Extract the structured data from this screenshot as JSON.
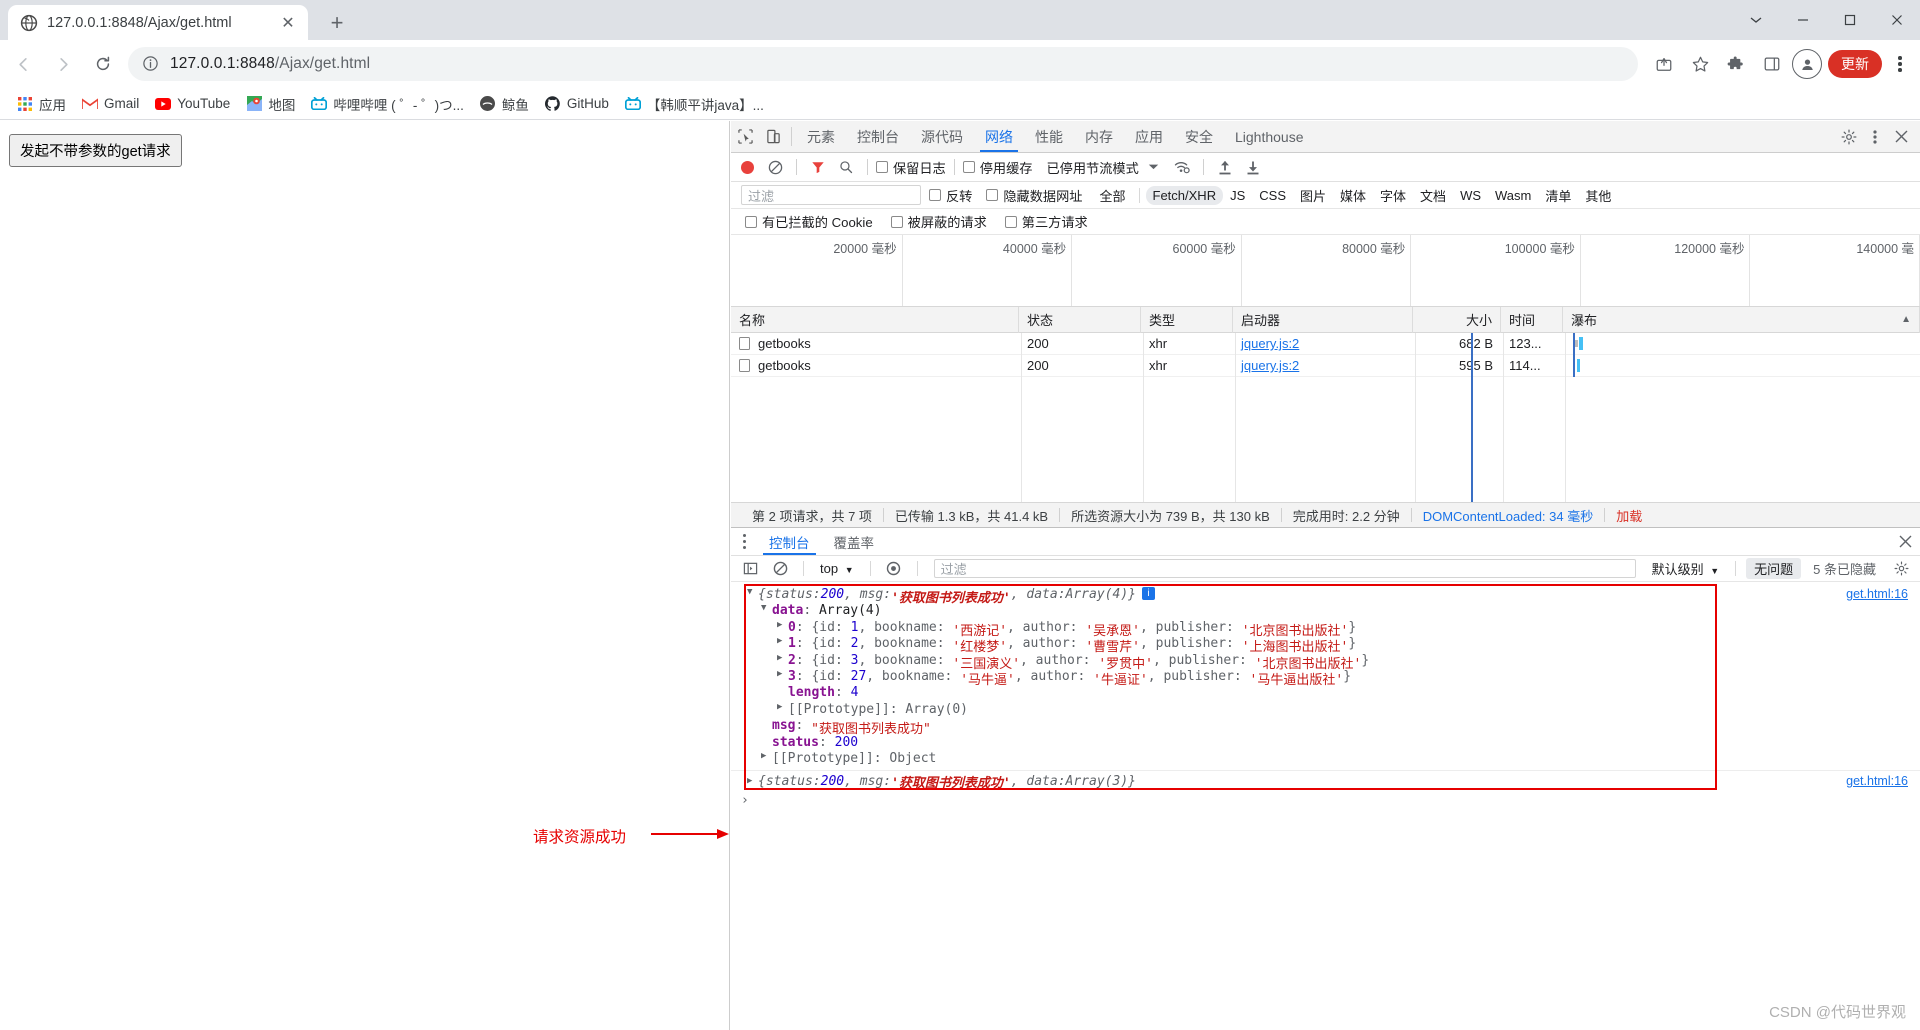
{
  "browser": {
    "tab": {
      "title": "127.0.0.1:8848/Ajax/get.html",
      "favicon": "globe-icon",
      "close": "✕"
    },
    "newtab_label": "+",
    "window_controls": {
      "restore_down": "⌄",
      "minimize": "─",
      "maximize": "❐",
      "close": "✕"
    },
    "nav": {
      "back": "←",
      "forward": "→",
      "reload": "↻"
    },
    "omnibox": {
      "info_icon": "info-circle-icon",
      "url_main": "127.0.0.1:8848",
      "url_path": "/Ajax/get.html"
    },
    "toolbar_icons": {
      "share": "⤴",
      "bookmark": "☆",
      "extensions": "ᾞ9",
      "sidepanel": "◫",
      "profile": "●"
    },
    "update_button": "更新",
    "bookmarks": [
      {
        "icon": "apps-grid-icon",
        "label": "应用"
      },
      {
        "icon": "gmail-icon",
        "label": "Gmail"
      },
      {
        "icon": "youtube-icon",
        "label": "YouTube"
      },
      {
        "icon": "maps-icon",
        "label": "地图"
      },
      {
        "icon": "bilibili-icon",
        "label": "哔哩哔哩 ( ゜- ゜)つ..."
      },
      {
        "icon": "whale-icon",
        "label": "鲸鱼"
      },
      {
        "icon": "github-icon",
        "label": "GitHub"
      },
      {
        "icon": "bilibili-icon",
        "label": "【韩顺平讲java】..."
      }
    ]
  },
  "page": {
    "button_label": "发起不带参数的get请求",
    "annotation": "请求资源成功"
  },
  "devtools": {
    "tabs": [
      {
        "label": "元素",
        "active": false
      },
      {
        "label": "控制台",
        "active": false
      },
      {
        "label": "源代码",
        "active": false
      },
      {
        "label": "网络",
        "active": true
      },
      {
        "label": "性能",
        "active": false
      },
      {
        "label": "内存",
        "active": false
      },
      {
        "label": "应用",
        "active": false
      },
      {
        "label": "安全",
        "active": false
      },
      {
        "label": "Lighthouse",
        "active": false
      }
    ],
    "inspect_icon": "inspect-cursor-icon",
    "device_icon": "device-toolbar-icon",
    "settings_icon": "gear-icon",
    "more_icon": "kebab-menu-icon",
    "close_icon": "close-icon",
    "network": {
      "toolbar": {
        "record": "record-button",
        "clear": "clear-icon",
        "filter": "funnel-icon",
        "search": "search-icon",
        "preserve_log": "保留日志",
        "disable_cache": "停用缓存",
        "throttle": "已停用节流模式",
        "wifi_icon": "network-conditions-icon",
        "import_icon": "upload-har-icon",
        "export_icon": "download-har-icon"
      },
      "filter_placeholder": "过滤",
      "invert": "反转",
      "hide_data_urls": "隐藏数据网址",
      "types": [
        {
          "label": "全部",
          "selected": false
        },
        {
          "label": "Fetch/XHR",
          "selected": true
        },
        {
          "label": "JS",
          "selected": false
        },
        {
          "label": "CSS",
          "selected": false
        },
        {
          "label": "图片",
          "selected": false
        },
        {
          "label": "媒体",
          "selected": false
        },
        {
          "label": "字体",
          "selected": false
        },
        {
          "label": "文档",
          "selected": false
        },
        {
          "label": "WS",
          "selected": false
        },
        {
          "label": "Wasm",
          "selected": false
        },
        {
          "label": "清单",
          "selected": false
        },
        {
          "label": "其他",
          "selected": false
        }
      ],
      "row2": [
        "有已拦截的 Cookie",
        "被屏蔽的请求",
        "第三方请求"
      ],
      "timeline_ticks": [
        "20000 毫秒",
        "40000 毫秒",
        "60000 毫秒",
        "80000 毫秒",
        "100000 毫秒",
        "120000 毫秒",
        "140000 毫"
      ],
      "columns": [
        "名称",
        "状态",
        "类型",
        "启动器",
        "大小",
        "时间",
        "瀑布"
      ],
      "sort_indicator": "▲",
      "rows": [
        {
          "name": "getbooks",
          "status": "200",
          "type": "xhr",
          "initiator": "jquery.js:2",
          "size": "682 B",
          "time": "123..."
        },
        {
          "name": "getbooks",
          "status": "200",
          "type": "xhr",
          "initiator": "jquery.js:2",
          "size": "595 B",
          "time": "114..."
        }
      ],
      "status_bar": {
        "requests": "第 2 项请求，共 7 项",
        "transferred": "已传输 1.3 kB，共 41.4 kB",
        "resources": "所选资源大小为 739 B，共 130 kB",
        "finish": "完成用时: 2.2 分钟",
        "dcl": "DOMContentLoaded: 34 毫秒",
        "load": "加载"
      }
    },
    "drawer": {
      "tabs": [
        {
          "label": "控制台",
          "active": true
        },
        {
          "label": "覆盖率",
          "active": false
        }
      ],
      "toolbar": {
        "sidebar_icon": "show-console-sidebar-icon",
        "clear_icon": "clear-console-icon",
        "context": "top",
        "eye_icon": "live-expression-icon",
        "filter_placeholder": "过滤",
        "level": "默认级别",
        "issues": "无问题",
        "hidden": "5 条已隐藏",
        "settings_icon": "gear-icon"
      },
      "console": {
        "entry1": {
          "header": {
            "arrow": "▼",
            "text_open": "{status: ",
            "status_val": "200",
            "comma1": ", msg: ",
            "msg_val": "'获取图书列表成功'",
            "comma2": ", data: ",
            "data_val": "Array(4)",
            "close": "}",
            "badge": "i"
          },
          "source": "get.html:16",
          "data_line": {
            "key": "data",
            "value": "Array(4)"
          },
          "items": [
            {
              "index": "0",
              "id": "1",
              "bookname": "'西游记'",
              "author": "'吴承恩'",
              "publisher": "'北京图书出版社'"
            },
            {
              "index": "1",
              "id": "2",
              "bookname": "'红楼梦'",
              "author": "'曹雪芹'",
              "publisher": "'上海图书出版社'"
            },
            {
              "index": "2",
              "id": "3",
              "bookname": "'三国演义'",
              "author": "'罗贯中'",
              "publisher": "'北京图书出版社'"
            },
            {
              "index": "3",
              "id": "27",
              "bookname": "'马牛逼'",
              "author": "'牛逼证'",
              "publisher": "'马牛逼出版社'"
            }
          ],
          "length_line": {
            "key": "length",
            "value": "4"
          },
          "proto_array": "[[Prototype]]: Array(0)",
          "msg_line": {
            "key": "msg",
            "value": "\"获取图书列表成功\""
          },
          "status_line": {
            "key": "status",
            "value": "200"
          },
          "proto_object": "[[Prototype]]: Object"
        },
        "entry2": {
          "arrow": "▶",
          "text_open": "{status: ",
          "status_val": "200",
          "comma1": ", msg: ",
          "msg_val": "'获取图书列表成功'",
          "comma2": ", data: ",
          "data_val": "Array(3)",
          "close": "}",
          "source": "get.html:16"
        },
        "prompt": "›"
      }
    }
  },
  "watermark": "CSDN @代码世界观",
  "colors": {
    "accent_blue": "#1a73e8",
    "annotation_red": "#e60000",
    "update_red": "#d93025",
    "record_red": "#e8413c"
  }
}
